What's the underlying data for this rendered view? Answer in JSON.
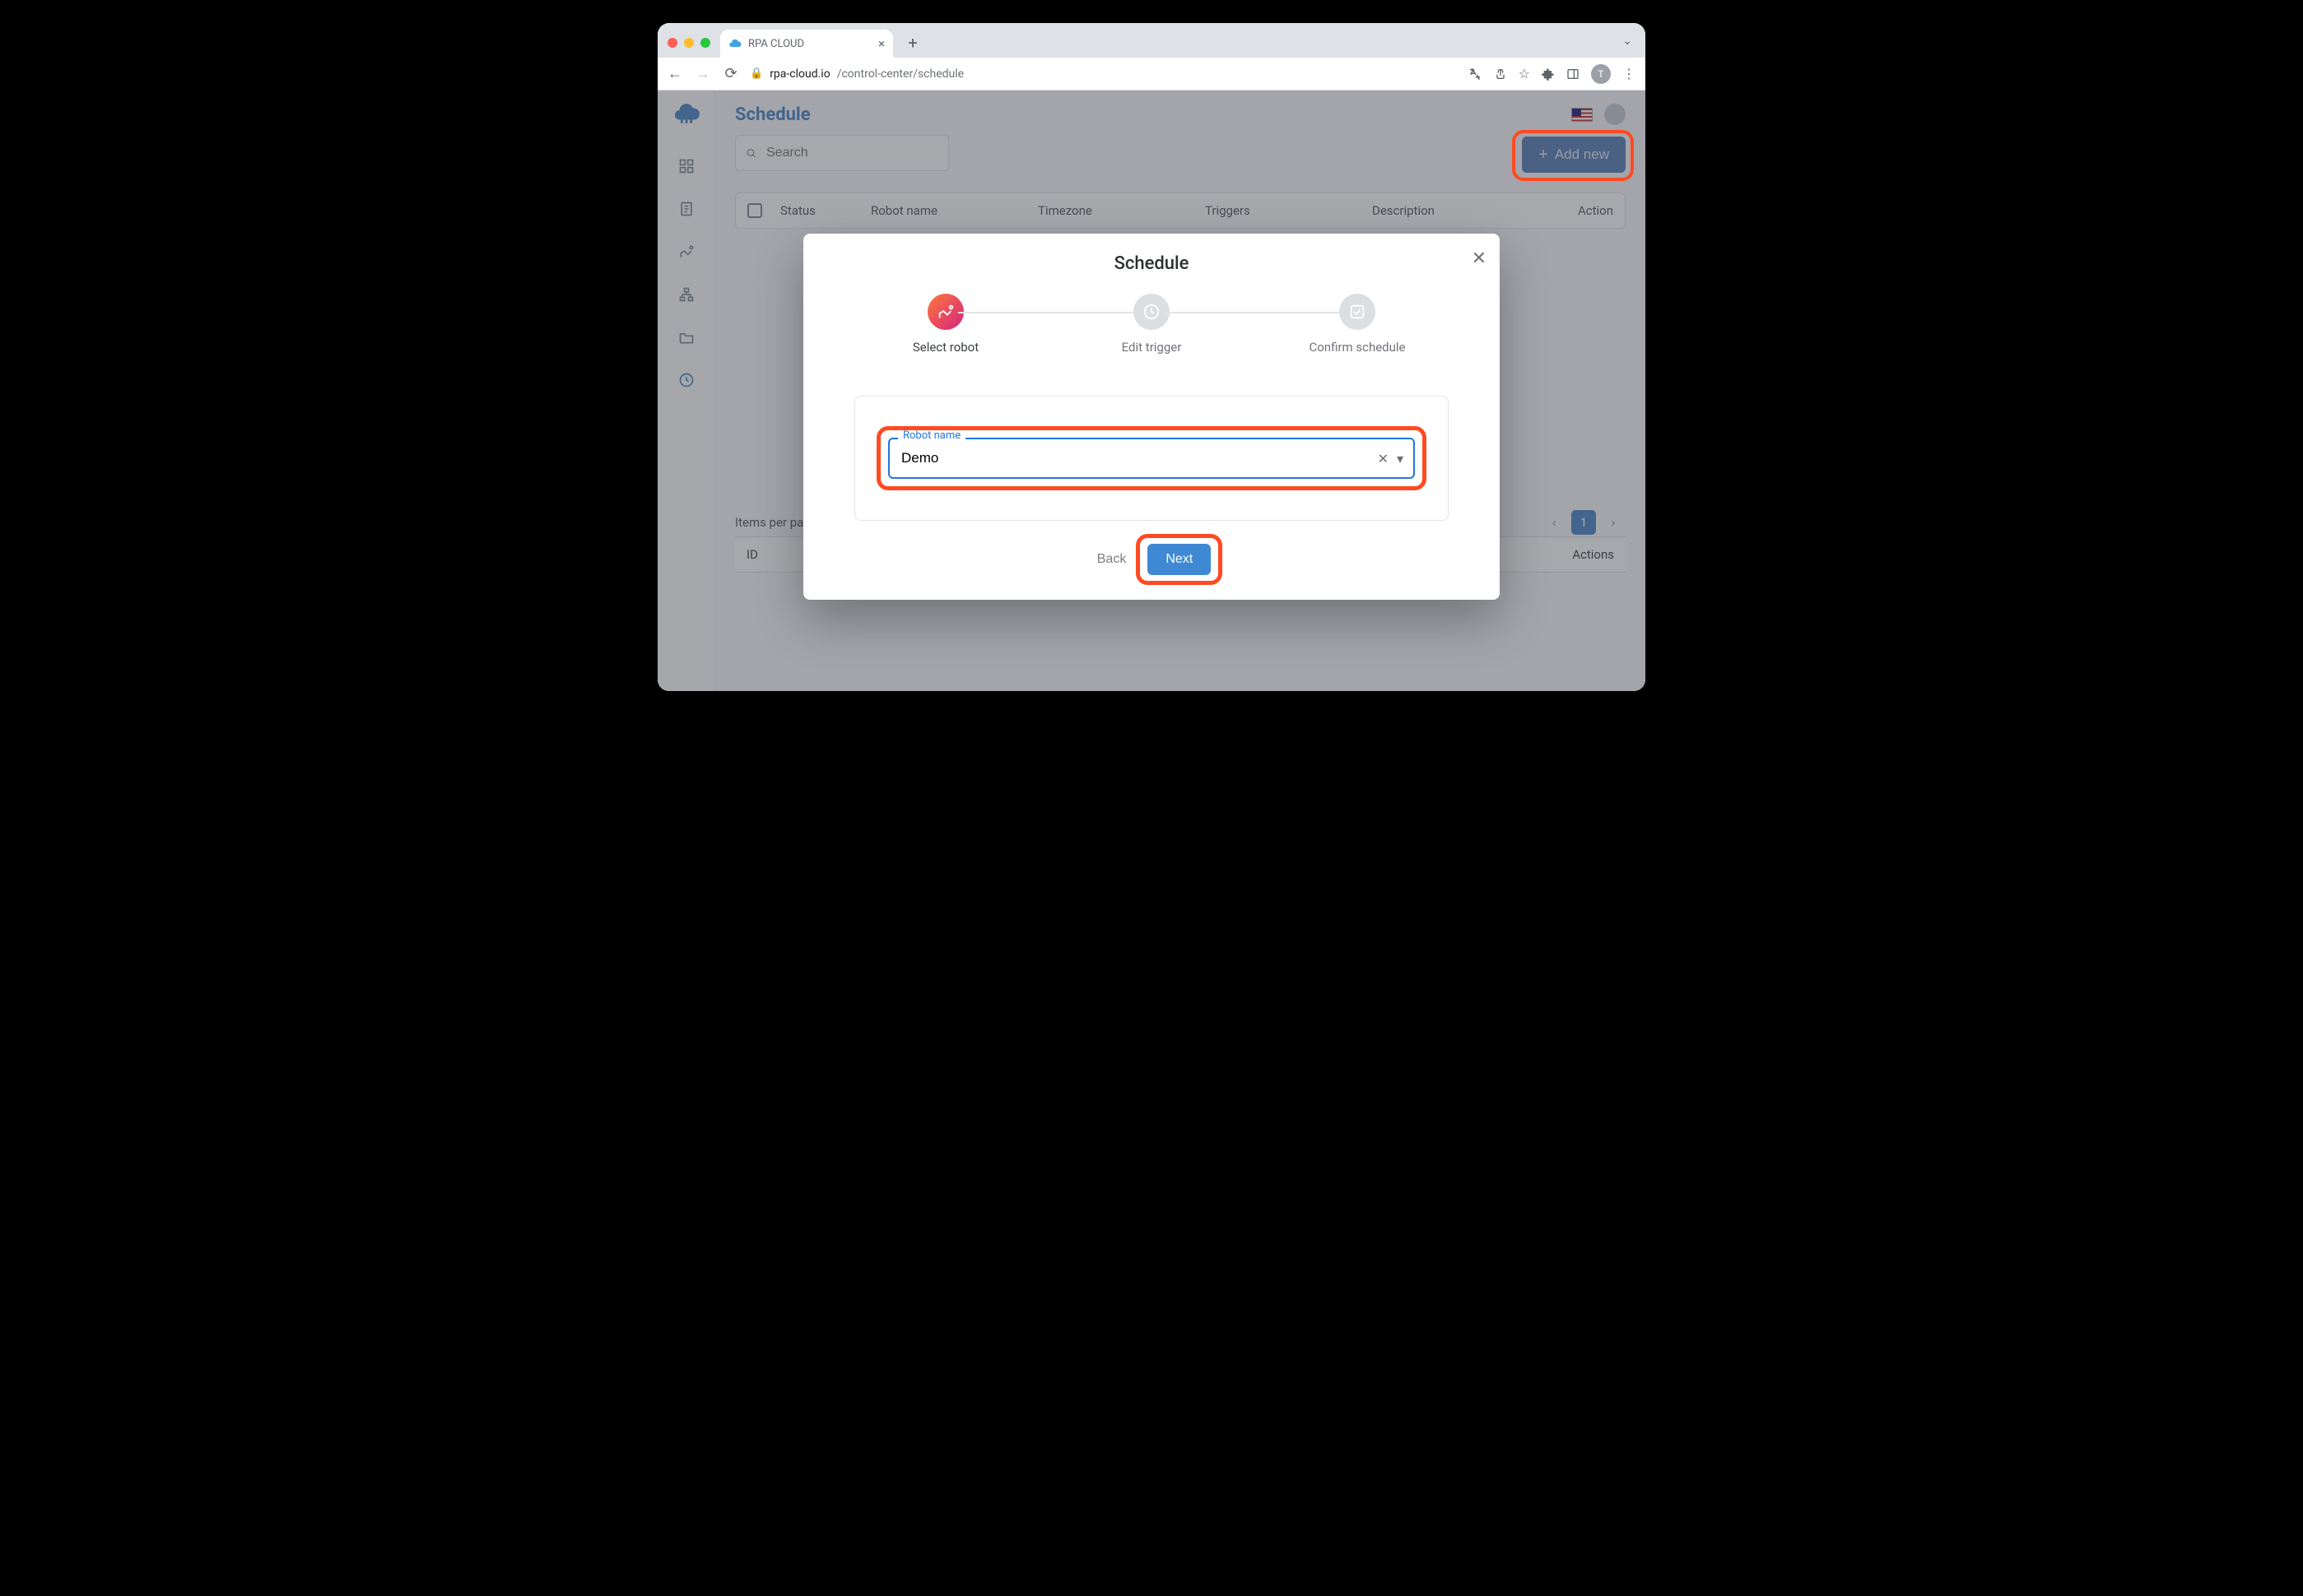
{
  "browser": {
    "tab_title": "RPA CLOUD",
    "url_host": "rpa-cloud.io",
    "url_path": "/control-center/schedule",
    "avatar_initial": "T"
  },
  "page": {
    "title": "Schedule",
    "search_placeholder": "Search",
    "add_new": "Add new",
    "columns": {
      "status": "Status",
      "robot": "Robot name",
      "timezone": "Timezone",
      "triggers": "Triggers",
      "description": "Description",
      "action": "Action"
    },
    "items_per_page": "Items per page",
    "current_page": "1",
    "tasks": {
      "id": "ID",
      "actions": "Actions"
    }
  },
  "modal": {
    "title": "Schedule",
    "steps": {
      "select": "Select robot",
      "edit": "Edit trigger",
      "confirm": "Confirm schedule"
    },
    "field_label": "Robot name",
    "field_value": "Demo",
    "back": "Back",
    "next": "Next"
  }
}
